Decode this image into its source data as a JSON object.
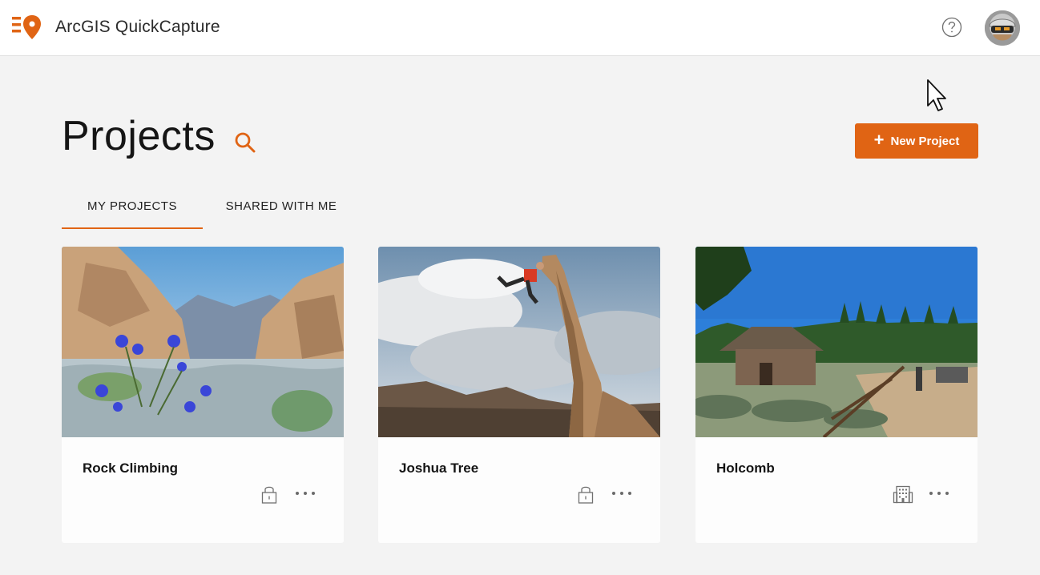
{
  "app": {
    "title": "ArcGIS QuickCapture",
    "brand_color": "#e06414"
  },
  "header": {
    "help_icon": "help-circle-icon",
    "avatar_icon": "user-avatar"
  },
  "page": {
    "title": "Projects",
    "search_icon": "search-icon"
  },
  "toolbar": {
    "new_project_label": "New Project",
    "new_project_icon": "plus-icon"
  },
  "tabs": [
    {
      "label": "MY PROJECTS",
      "active": true
    },
    {
      "label": "SHARED WITH ME",
      "active": false
    }
  ],
  "projects": [
    {
      "title": "Rock Climbing",
      "sharing": "lock-icon",
      "thumbnail": "desert rocks with blue wildflowers"
    },
    {
      "title": "Joshua Tree",
      "sharing": "lock-icon",
      "thumbnail": "climber on rock pillar under cloudy sky"
    },
    {
      "title": "Holcomb",
      "sharing": "organization-icon",
      "thumbnail": "wooden cabin in meadow with pine trees"
    }
  ]
}
